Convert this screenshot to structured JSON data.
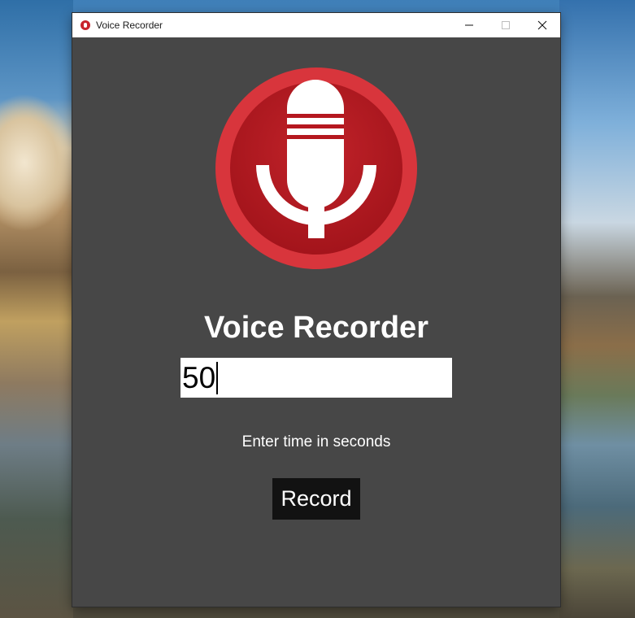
{
  "window": {
    "title": "Voice Recorder",
    "icon": "microphone-icon",
    "controls": [
      "minimize-icon",
      "maximize-icon",
      "close-icon"
    ]
  },
  "app": {
    "logo_icon": "microphone-icon",
    "heading": "Voice Recorder",
    "time_input": {
      "value": "50"
    },
    "hint": "Enter time in seconds",
    "record_label": "Record"
  },
  "colors": {
    "window_bg": "#474747",
    "logo_red": "#c8232c",
    "button_bg": "#121212",
    "text": "#ffffff"
  }
}
